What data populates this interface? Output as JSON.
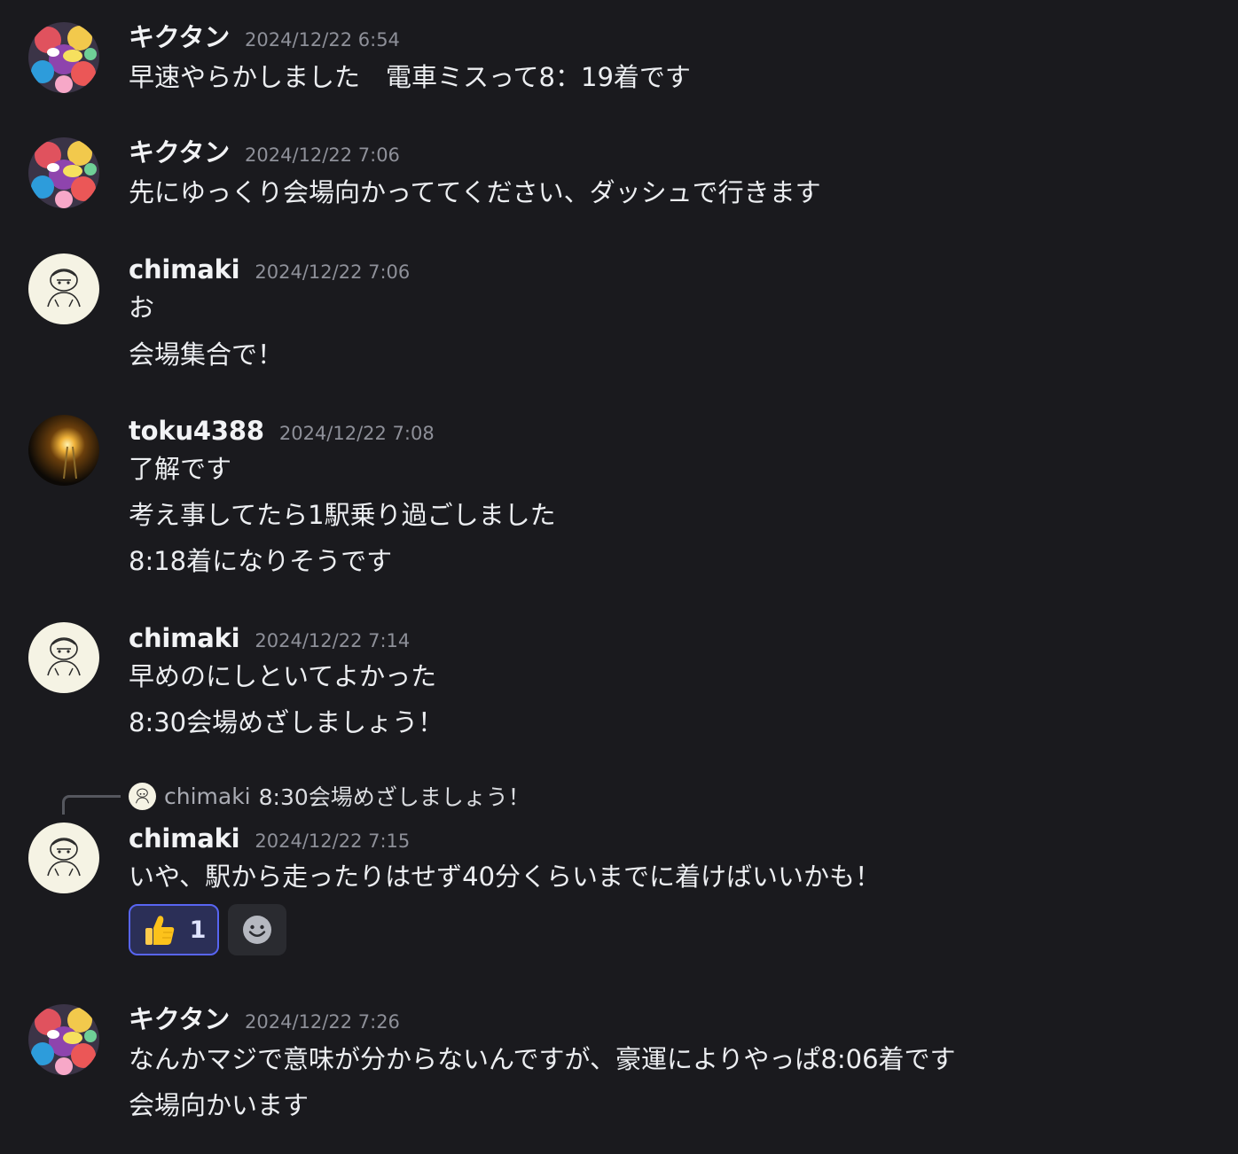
{
  "messages": [
    {
      "author": "キクタン",
      "avatar": "kikutan-avatar",
      "timestamp": "2024/12/22 6:54",
      "lines": [
        "早速やらかしました　電車ミスって8：19着です"
      ]
    },
    {
      "author": "キクタン",
      "avatar": "kikutan-avatar",
      "timestamp": "2024/12/22 7:06",
      "lines": [
        "先にゆっくり会場向かっててください、ダッシュで行きます"
      ]
    },
    {
      "author": "chimaki",
      "avatar": "chimaki-avatar",
      "timestamp": "2024/12/22 7:06",
      "lines": [
        "お",
        "会場集合で！"
      ]
    },
    {
      "author": "toku4388",
      "avatar": "toku-avatar",
      "timestamp": "2024/12/22 7:08",
      "lines": [
        "了解です",
        "考え事してたら1駅乗り過ごしました",
        "8:18着になりそうです"
      ]
    },
    {
      "author": "chimaki",
      "avatar": "chimaki-avatar",
      "timestamp": "2024/12/22 7:14",
      "lines": [
        "早めのにしといてよかった",
        "8:30会場めざしましょう！"
      ]
    },
    {
      "author": "chimaki",
      "avatar": "chimaki-avatar",
      "timestamp": "2024/12/22 7:15",
      "reply_to": {
        "author": "chimaki",
        "text": "8:30会場めざしましょう！"
      },
      "lines": [
        "いや、駅から走ったりはせず40分くらいまでに着けばいいかも！"
      ],
      "reactions": [
        {
          "emoji": "thumbs-up-icon",
          "count": "1",
          "active": true
        }
      ],
      "add_reaction_icon": "smiley-icon"
    },
    {
      "author": "キクタン",
      "avatar": "kikutan-avatar",
      "timestamp": "2024/12/22 7:26",
      "lines": [
        "なんかマジで意味が分からないんですが、豪運によりやっぱ8:06着です",
        "会場向かいます"
      ]
    }
  ],
  "colors": {
    "background": "#1a1a1e",
    "text": "#f2f3f5",
    "timestamp": "#8e9099",
    "reaction_border": "#5865f2",
    "reaction_bg": "#2b2f57"
  }
}
